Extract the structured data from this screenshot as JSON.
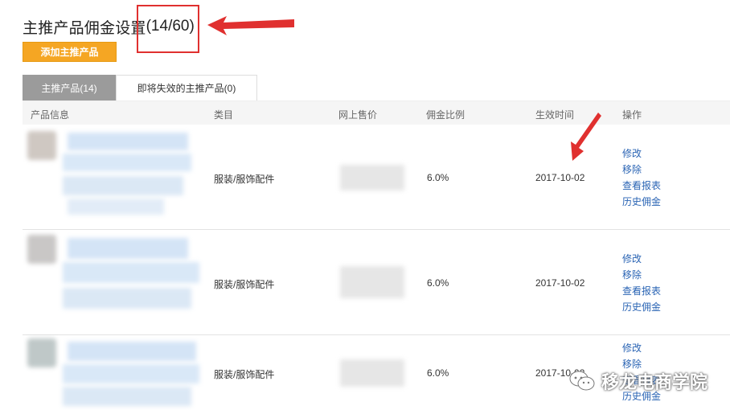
{
  "header": {
    "title": "主推产品佣金设置",
    "count": "(14/60)",
    "add_button": "添加主推产品"
  },
  "tabs": [
    {
      "label": "主推产品(14)",
      "active": true
    },
    {
      "label": "即将失效的主推产品(0)",
      "active": false
    }
  ],
  "table": {
    "columns": [
      "产品信息",
      "类目",
      "网上售价",
      "佣金比例",
      "生效时间",
      "操作"
    ],
    "rows": [
      {
        "category": "服装/服饰配件",
        "rate": "6.0%",
        "date": "2017-10-02",
        "ops": [
          "修改",
          "移除",
          "查看报表",
          "历史佣金"
        ]
      },
      {
        "category": "服装/服饰配件",
        "rate": "6.0%",
        "date": "2017-10-02",
        "ops": [
          "修改",
          "移除",
          "查看报表",
          "历史佣金"
        ]
      },
      {
        "category": "服装/服饰配件",
        "rate": "6.0%",
        "date": "2017-10-02",
        "ops": [
          "修改",
          "移除",
          "查看报表",
          "历史佣金"
        ]
      }
    ]
  },
  "watermark": {
    "text": "移龙电商学院"
  },
  "colors": {
    "accent_button": "#f5a623",
    "active_tab": "#9b9b9b",
    "link": "#2a64b4",
    "annotation_red": "#e0302f"
  }
}
